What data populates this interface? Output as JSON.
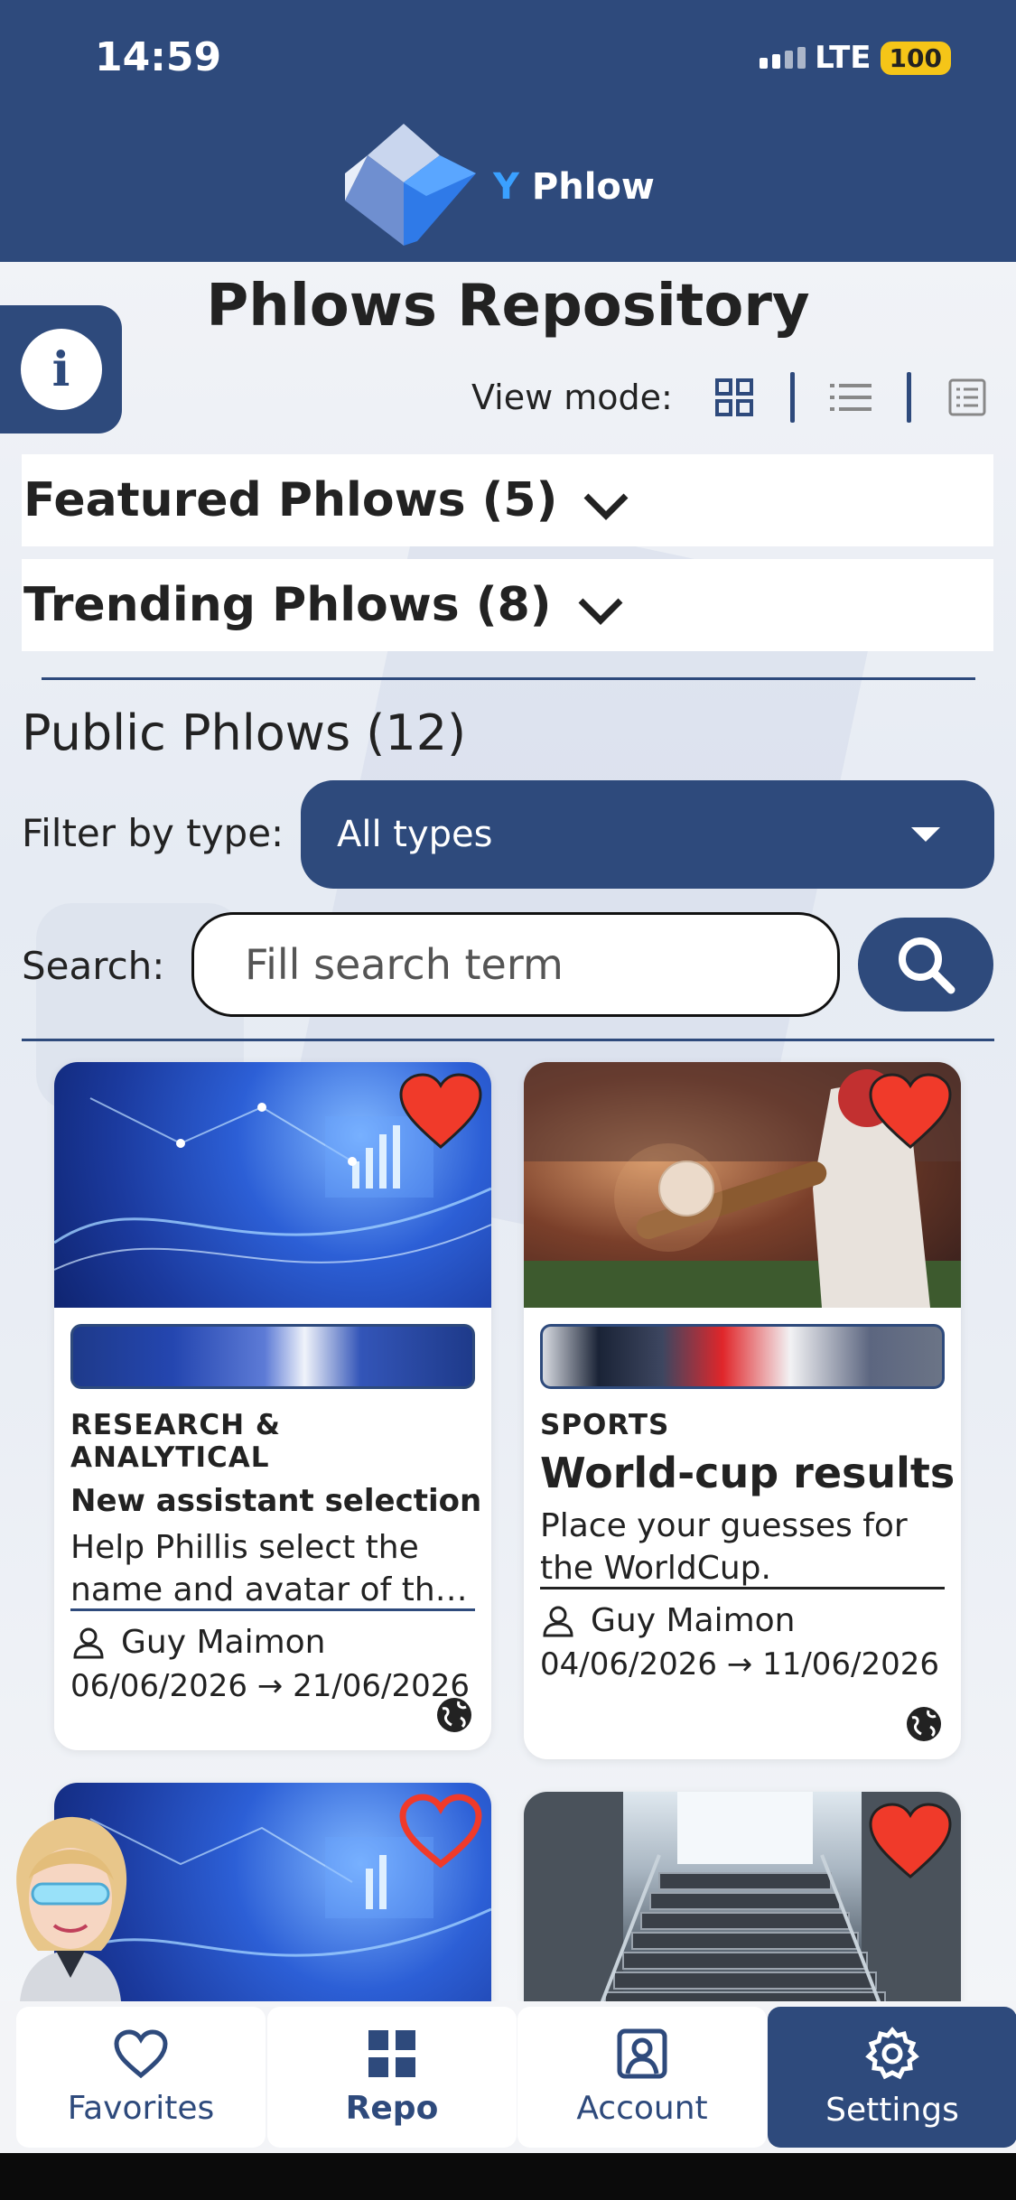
{
  "status_bar": {
    "time": "14:59",
    "network": "LTE",
    "battery": "100"
  },
  "header": {
    "logo_y": "Y",
    "logo_text": "Phlow"
  },
  "page_title": "Phlows Repository",
  "view_mode": {
    "label": "View mode:",
    "options": [
      "grid",
      "list",
      "detail"
    ],
    "selected": "grid"
  },
  "sections": {
    "featured": "Featured Phlows (5)",
    "trending": "Trending Phlows (8)"
  },
  "public": {
    "title": "Public Phlows (12)",
    "filter_label": "Filter by type:",
    "filter_value": "All types",
    "search_label": "Search:",
    "search_placeholder": "Fill search term"
  },
  "cards": [
    {
      "type": "RESEARCH & ANALYTICAL",
      "title": "New assistant selection",
      "description": "Help Phillis select the name and avatar of the new assistant",
      "author": "Guy Maimon",
      "dates": "06/06/2026 → 21/06/2026",
      "favorite": true
    },
    {
      "type": "SPORTS",
      "title": "World-cup results",
      "description": "Place your guesses for the WorldCup.",
      "author": "Guy Maimon",
      "dates": "04/06/2026 → 11/06/2026",
      "favorite": true
    },
    {
      "favorite": false
    },
    {
      "favorite": true
    }
  ],
  "colors": {
    "primary": "#2e4a7c",
    "heart": "#f03a2a",
    "accent": "#3aa0ff"
  },
  "bottom_nav": [
    {
      "label": "Favorites",
      "icon": "heart-icon"
    },
    {
      "label": "Repo",
      "icon": "grid-icon"
    },
    {
      "label": "Account",
      "icon": "account-icon"
    },
    {
      "label": "Settings",
      "icon": "gear-icon"
    }
  ]
}
